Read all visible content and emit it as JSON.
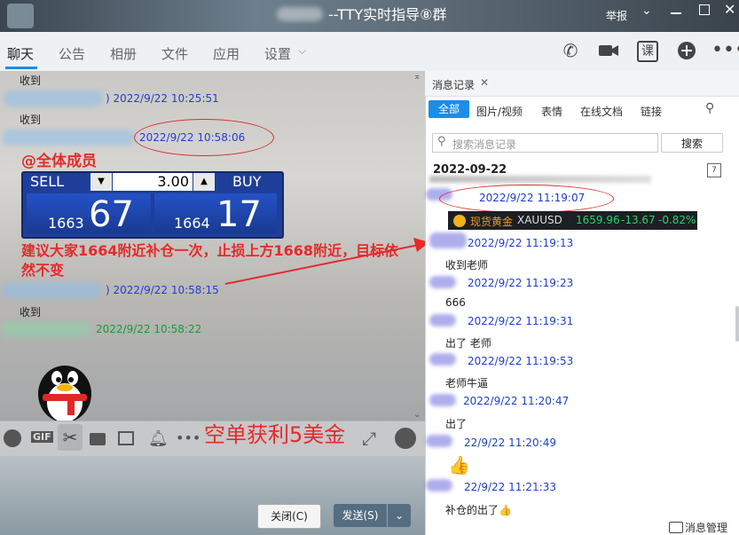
{
  "window": {
    "title": "--TTY实时指导⑧群",
    "report": "举报"
  },
  "tabs": [
    {
      "label": "聊天",
      "active": true
    },
    {
      "label": "公告"
    },
    {
      "label": "相册"
    },
    {
      "label": "文件"
    },
    {
      "label": "应用"
    },
    {
      "label": "设置"
    }
  ],
  "top_icons": [
    "phone-icon",
    "video-icon",
    "lesson-icon",
    "add-icon",
    "more-icon"
  ],
  "top_lesson_label": "课",
  "chat": {
    "messages": [
      {
        "text": "收到"
      },
      {
        "time": "2022/9/22 10:25:51",
        "prefix": ")"
      },
      {
        "text": "收到"
      },
      {
        "time": "2022/9/22 10:58:06"
      },
      {
        "mention": "@全体成员"
      },
      {
        "time": "2022/9/22 10:58:15",
        "prefix": ")"
      },
      {
        "text": "收到"
      },
      {
        "time": "2022/9/22 10:58:22"
      }
    ],
    "trade": {
      "sell_label": "SELL",
      "buy_label": "BUY",
      "qty": "3.00",
      "sell_small": "1663",
      "sell_big": "67",
      "buy_small": "1664",
      "buy_big": "17"
    },
    "annotation": "建议大家1664附近补仓一次，止损上方1668附近，目标依然不变",
    "overlay_caption": "空单获利5美金"
  },
  "input_toolbar": [
    "emoji-icon",
    "gif-icon",
    "scissors-icon",
    "folder-icon",
    "image-icon",
    "bell-icon",
    "more-icon"
  ],
  "gif_label": "GIF",
  "buttons": {
    "close": "关闭(C)",
    "send": "发送(S)"
  },
  "history": {
    "tab_label": "消息记录",
    "filters": [
      "全部",
      "图片/视频",
      "表情",
      "在线文档",
      "链接"
    ],
    "search_placeholder": "搜索消息记录",
    "search_button": "搜索",
    "date": "2022-09-22",
    "entries": [
      {
        "time": "2022/9/22 11:19:07"
      },
      {
        "time": "2022/9/22 11:19:13",
        "text": "收到老师"
      },
      {
        "time": "2022/9/22 11:19:23",
        "text": "666"
      },
      {
        "time": "2022/9/22 11:19:31",
        "text": "出了  老师"
      },
      {
        "time": "2022/9/22 11:19:53",
        "text": "老师牛逼"
      },
      {
        "time": "2022/9/22 11:20:47",
        "text": "出了"
      },
      {
        "time": "22/9/22 11:20:49",
        "text": "👍"
      },
      {
        "time": "22/9/22 11:21:33",
        "text": "补仓的出了👍"
      }
    ],
    "ticker": {
      "name": "现货黄金",
      "symbol": "XAUUSD",
      "price": "1659.96",
      "change": "-13.67",
      "pct": "-0.82%"
    },
    "footer": "消息管理"
  },
  "colors": {
    "accent": "#1a8ee8",
    "annotation": "#e62a2a",
    "time_blue": "#1f3fd0",
    "time_green": "#1a9a35"
  }
}
